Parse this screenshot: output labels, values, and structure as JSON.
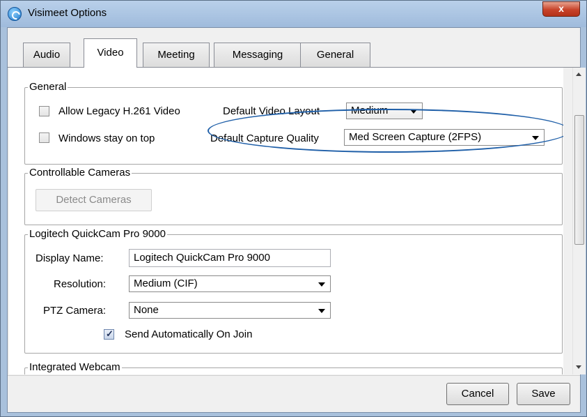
{
  "window": {
    "title": "Visimeet Options",
    "close_glyph": "x"
  },
  "tabs": [
    {
      "label": "Audio",
      "active": false
    },
    {
      "label": "Video",
      "active": true
    },
    {
      "label": "Meeting",
      "active": false
    },
    {
      "label": "Messaging",
      "active": false
    },
    {
      "label": "General",
      "active": false
    }
  ],
  "general": {
    "legend": "General",
    "legacy_h261_label": "Allow Legacy H.261 Video",
    "legacy_h261_checked": false,
    "windows_top_label": "Windows stay on top",
    "windows_top_checked": false,
    "default_layout_label": "Default Video Layout",
    "default_layout_value": "Medium",
    "default_capture_label": "Default Capture Quality",
    "default_capture_value": "Med Screen Capture (2FPS)"
  },
  "cameras": {
    "legend": "Controllable Cameras",
    "detect_label": "Detect Cameras"
  },
  "webcam_device": {
    "legend": "Logitech QuickCam Pro 9000",
    "display_name_label": "Display Name:",
    "display_name_value": "Logitech QuickCam Pro 9000",
    "resolution_label": "Resolution:",
    "resolution_value": "Medium (CIF)",
    "ptz_label": "PTZ Camera:",
    "ptz_value": "None",
    "send_auto_label": "Send Automatically On Join",
    "send_auto_checked": true,
    "check_glyph": "✓"
  },
  "integrated_webcam": {
    "legend": "Integrated Webcam"
  },
  "footer": {
    "cancel_label": "Cancel",
    "save_label": "Save"
  },
  "colors": {
    "annotation_ellipse": "#1f5fa8",
    "close_button": "#c7432a"
  }
}
